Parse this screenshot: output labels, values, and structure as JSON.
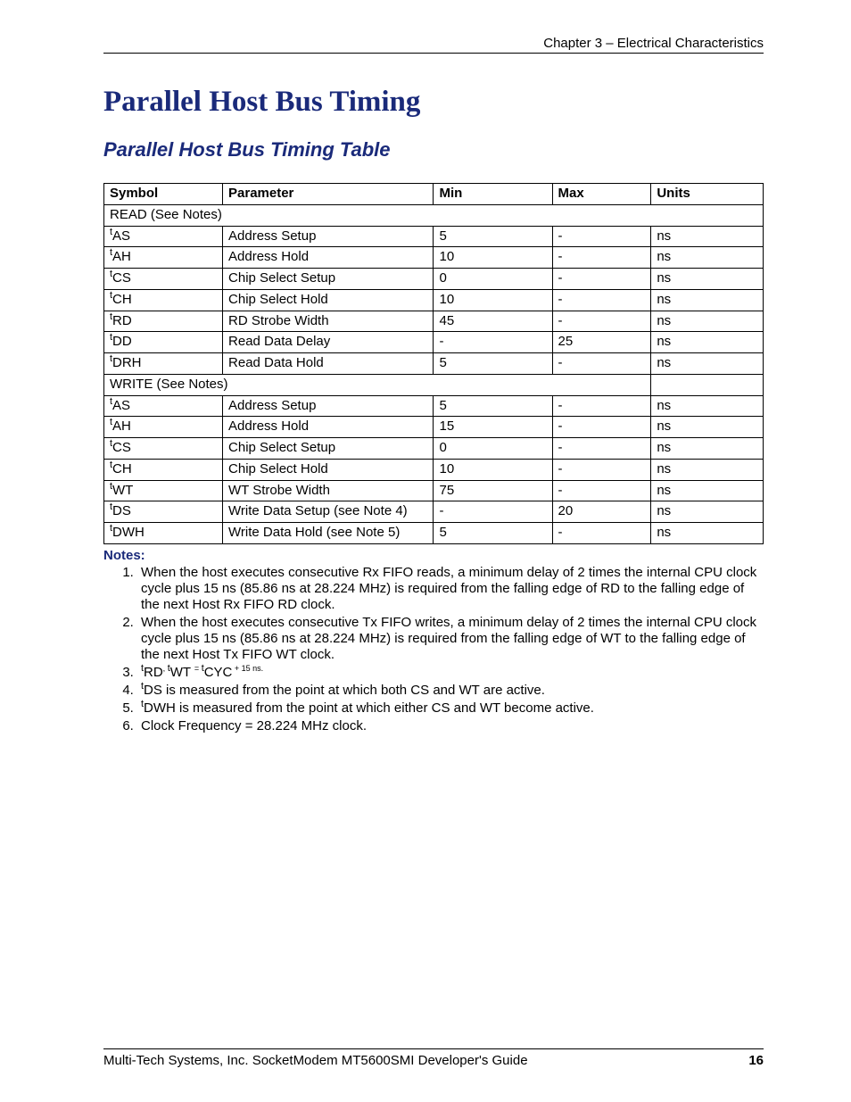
{
  "header": {
    "chapter": "Chapter 3 – Electrical Characteristics"
  },
  "titles": {
    "main": "Parallel Host Bus Timing",
    "sub": "Parallel Host Bus Timing Table"
  },
  "table": {
    "headers": {
      "symbol": "Symbol",
      "parameter": "Parameter",
      "min": "Min",
      "max": "Max",
      "units": "Units"
    },
    "read_label": "READ (See Notes)",
    "write_label": "WRITE (See Notes)",
    "read_rows": [
      {
        "sym": "AS",
        "param": "Address Setup",
        "min": "5",
        "max": "-",
        "units": "ns"
      },
      {
        "sym": "AH",
        "param": "Address Hold",
        "min": "10",
        "max": "-",
        "units": "ns"
      },
      {
        "sym": "CS",
        "param": "Chip Select Setup",
        "min": "0",
        "max": "-",
        "units": "ns"
      },
      {
        "sym": "CH",
        "param": "Chip Select Hold",
        "min": "10",
        "max": "-",
        "units": "ns"
      },
      {
        "sym": "RD",
        "param": "RD Strobe Width",
        "min": "45",
        "max": "-",
        "units": "ns"
      },
      {
        "sym": "DD",
        "param": "Read Data Delay",
        "min": "-",
        "max": "25",
        "units": "ns"
      },
      {
        "sym": "DRH",
        "param": "Read Data Hold",
        "min": "5",
        "max": "-",
        "units": "ns"
      }
    ],
    "write_rows": [
      {
        "sym": "AS",
        "param": "Address Setup",
        "min": "5",
        "max": "-",
        "units": "ns"
      },
      {
        "sym": "AH",
        "param": "Address Hold",
        "min": "15",
        "max": "-",
        "units": "ns"
      },
      {
        "sym": "CS",
        "param": "Chip Select Setup",
        "min": "0",
        "max": "-",
        "units": "ns"
      },
      {
        "sym": "CH",
        "param": "Chip Select Hold",
        "min": "10",
        "max": "-",
        "units": "ns"
      },
      {
        "sym": "WT",
        "param": "WT Strobe Width",
        "min": "75",
        "max": "-",
        "units": "ns"
      },
      {
        "sym": "DS",
        "param": "Write Data Setup (see Note 4)",
        "min": "-",
        "max": "20",
        "units": "ns"
      },
      {
        "sym": "DWH",
        "param": "Write Data Hold (see Note 5)",
        "min": "5",
        "max": "-",
        "units": "ns"
      }
    ]
  },
  "notes": {
    "label": "Notes:",
    "items": [
      "When the host executes consecutive Rx FIFO reads, a minimum delay of 2 times the internal CPU clock cycle plus 15 ns (85.86 ns at 28.224 MHz) is required from the falling edge of RD to the falling edge of the next Host Rx FIFO RD clock.",
      "When the host executes consecutive Tx FIFO writes, a minimum delay of 2 times the internal CPU clock cycle plus 15 ns (85.86 ns at 28.224 MHz) is required from the falling edge of WT to the falling edge of the next Host Tx FIFO WT clock.",
      "",
      "DS is measured from the point at which both CS and WT are active.",
      "DWH is measured from the point at which either CS and WT become active.",
      "Clock Frequency = 28.224 MHz clock."
    ],
    "note3_parts": {
      "rd": "RD",
      "wt": "WT",
      "cyc": "CYC",
      "tail": " + 15 ns."
    }
  },
  "footer": {
    "text": "Multi-Tech Systems, Inc. SocketModem MT5600SMI Developer's Guide",
    "page": "16"
  }
}
